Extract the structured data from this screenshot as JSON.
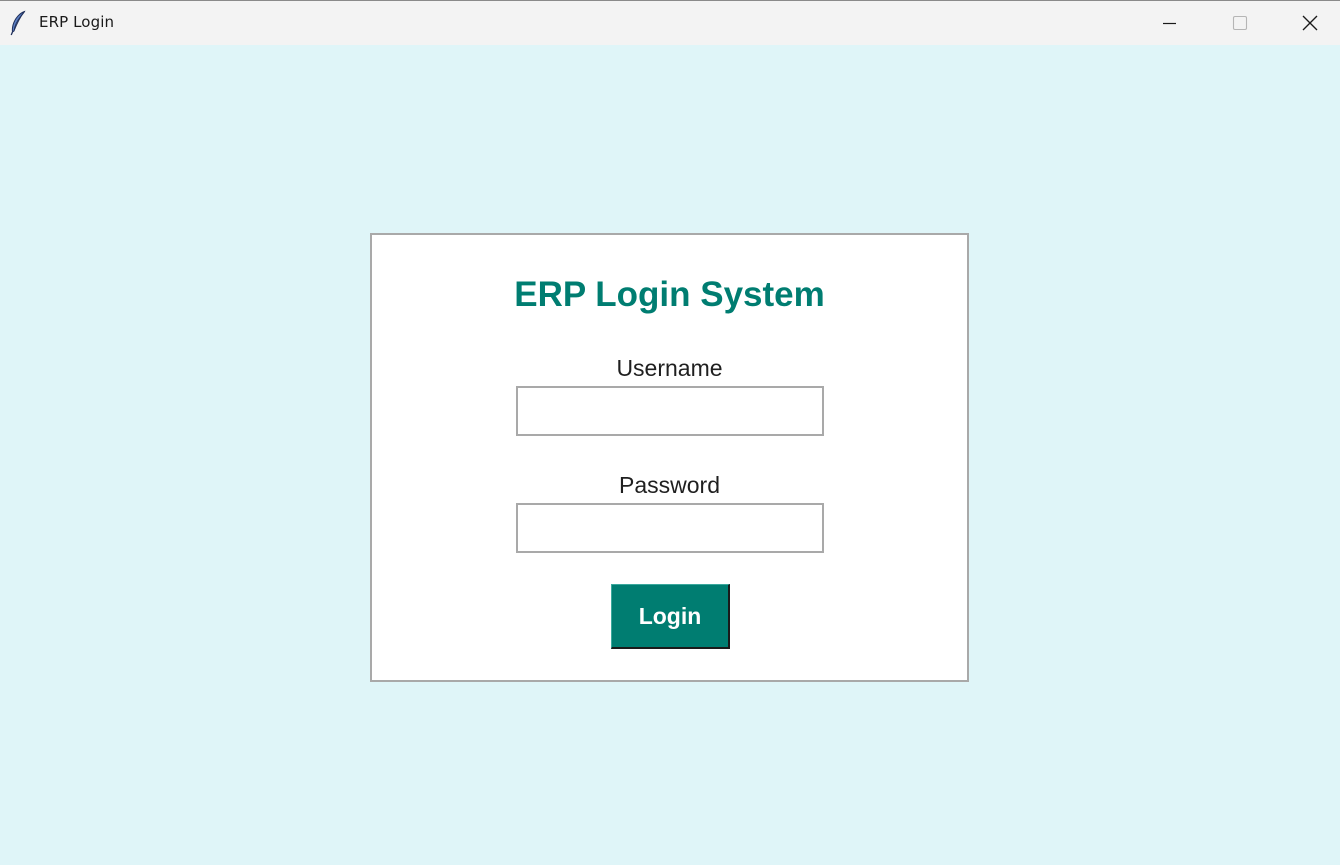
{
  "window": {
    "title": "ERP Login",
    "icon": "feather-icon",
    "controls": {
      "minimize_icon": "minimize-icon",
      "maximize_icon": "maximize-icon",
      "close_icon": "close-icon"
    }
  },
  "colors": {
    "background": "#dff5f8",
    "accent": "#007d71",
    "card": "#ffffff",
    "border": "#a9a9a9"
  },
  "login_form": {
    "title": "ERP Login System",
    "username_label": "Username",
    "username_value": "",
    "password_label": "Password",
    "password_value": "",
    "login_button_label": "Login"
  }
}
